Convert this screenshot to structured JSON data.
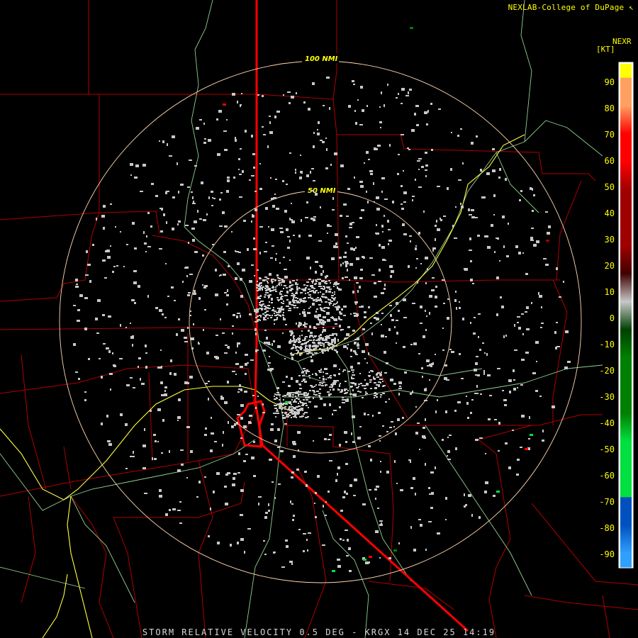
{
  "header": {
    "credit": "NEXLAB-College of DuPage",
    "product_code": "NEXR",
    "unit_label": "[KT]"
  },
  "footer": {
    "caption": "STORM RELATIVE VELOCITY 0.5 DEG - KRGX 14 DEC 25 14:19"
  },
  "range_rings": [
    {
      "label": "100 NMI"
    },
    {
      "label": "50 NMI"
    }
  ],
  "color_scale": {
    "ticks": [
      "90",
      "80",
      "70",
      "60",
      "50",
      "40",
      "30",
      "20",
      "10",
      "0",
      "-10",
      "-20",
      "-30",
      "-40",
      "-50",
      "-60",
      "-70",
      "-80",
      "-90"
    ],
    "colors": {
      "max": "#ffff00",
      "high": "#ffa060",
      "strong_out": "#ff0000",
      "mid_out": "#a00000",
      "weak_out": "#400000",
      "neutral": "#c8c8c8",
      "weak_in": "#004000",
      "mid_in": "#008000",
      "strong_in": "#00e040",
      "very_strong_in": "#0050c0",
      "min": "#30a0ff"
    }
  },
  "map_colors": {
    "county_lines": "#b00000",
    "state_line": "#ff0000",
    "highways": "#90d090",
    "interstate": "#ffff40",
    "range_rings": "#ffd8b0",
    "echoes": "#c8c8c8"
  }
}
